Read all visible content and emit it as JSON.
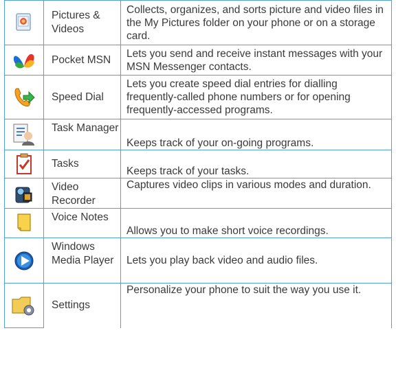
{
  "rows": [
    {
      "name": "Pictures & Videos",
      "desc": "Collects, organizes, and sorts picture and video files in the My Pictures folder on your phone or on a storage card.",
      "icon": "pictures-videos-icon"
    },
    {
      "name": "Pocket MSN",
      "desc": "Lets you send and receive instant messages with your MSN Messenger contacts.",
      "icon": "msn-butterfly-icon"
    },
    {
      "name": "Speed Dial",
      "desc": "Lets you create speed dial entries for dialling frequently-called phone numbers or for opening frequently-accessed programs.",
      "icon": "speed-dial-phone-icon"
    },
    {
      "name": "Task Manager",
      "desc": "Keeps track of your on-going programs.",
      "icon": "task-manager-icon"
    },
    {
      "name": "Tasks",
      "desc": "Keeps track of your tasks.",
      "icon": "tasks-checklist-icon"
    },
    {
      "name": "Video Recorder",
      "desc": "Captures video clips in various modes and duration.",
      "icon": "video-camera-icon"
    },
    {
      "name": "Voice Notes",
      "desc": "Allows you to make short voice recordings.",
      "icon": "voice-notes-icon"
    },
    {
      "name": "Windows Media Player",
      "desc": "Lets you play back video and audio files.",
      "icon": "media-player-icon"
    },
    {
      "name": "Settings",
      "desc": "Personalize your phone to suit the way you use it.",
      "icon": "settings-folder-gear-icon"
    }
  ]
}
